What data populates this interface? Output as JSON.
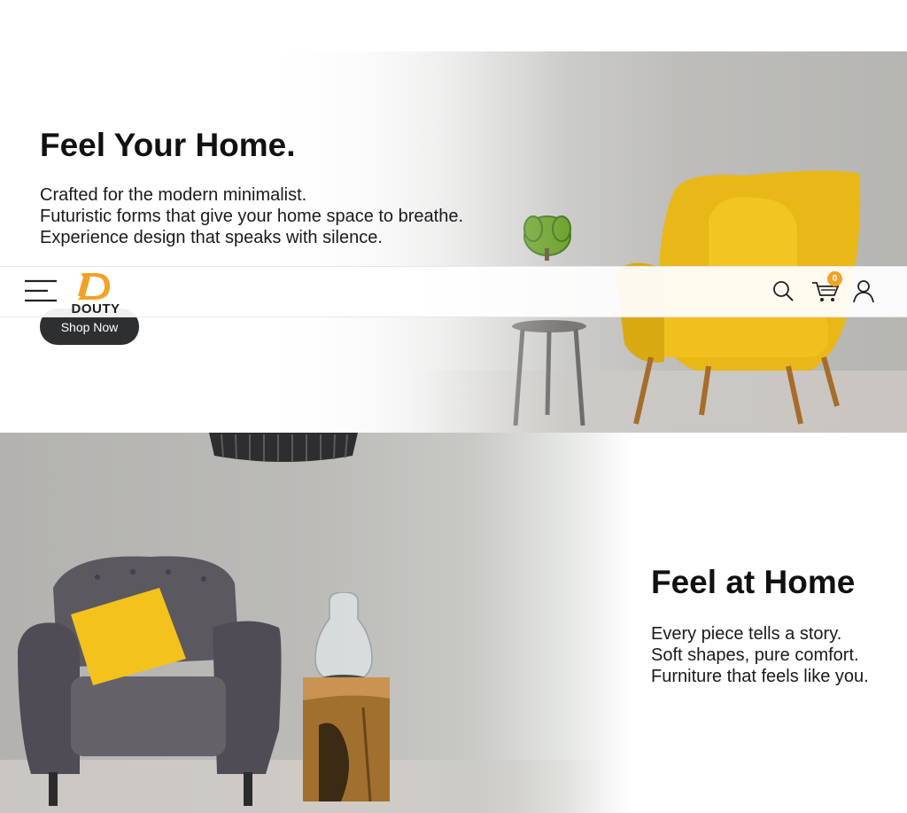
{
  "hero1": {
    "title": "Feel Your Home.",
    "lines": [
      "Crafted for the modern minimalist.",
      "Futuristic forms that give your home space to breathe.",
      "Experience design that speaks with silence."
    ],
    "cta": "Shop Now"
  },
  "nav": {
    "logo_text": "DOUTY",
    "cart_count": "0",
    "icons": [
      "menu-icon",
      "search-icon",
      "cart-icon",
      "user-icon"
    ]
  },
  "hero2": {
    "title": "Feel at Home",
    "lines": [
      "Every piece tells a story.",
      "Soft shapes, pure comfort.",
      "Furniture that feels like you."
    ]
  },
  "colors": {
    "accent": "#f2a227",
    "button": "#2d2f31",
    "chair_yellow": "#e8b818",
    "armchair_gray": "#55525a"
  }
}
